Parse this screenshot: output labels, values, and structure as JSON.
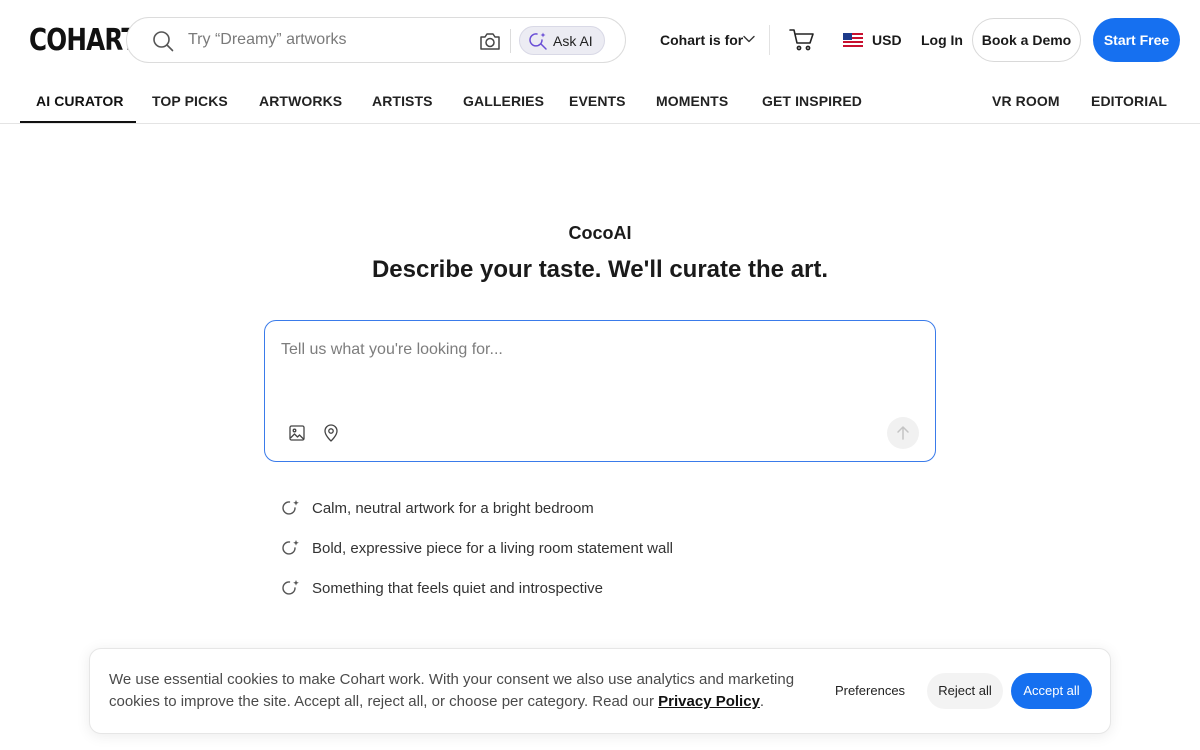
{
  "header": {
    "logo": "COHART",
    "search": {
      "placeholder": "Try “Dreamy” artworks",
      "ask_ai_label": "Ask AI"
    },
    "audience_menu_label": "Cohart is for",
    "currency": "USD",
    "login_label": "Log In",
    "demo_label": "Book a Demo",
    "start_label": "Start Free",
    "icons": {
      "search": "search-icon",
      "camera": "camera-icon",
      "ask_ai": "sparkle-search-icon",
      "cart": "cart-icon",
      "flag": "us-flag-icon",
      "chevron": "chevron-down-icon"
    }
  },
  "nav": {
    "items": [
      {
        "label": "AI CURATOR",
        "active": true
      },
      {
        "label": "TOP PICKS"
      },
      {
        "label": "ARTWORKS"
      },
      {
        "label": "ARTISTS"
      },
      {
        "label": "GALLERIES"
      },
      {
        "label": "EVENTS"
      },
      {
        "label": "MOMENTS"
      },
      {
        "label": "GET INSPIRED"
      },
      {
        "label": "VR ROOM"
      },
      {
        "label": "EDITORIAL"
      }
    ]
  },
  "main": {
    "brand": "CocoAI",
    "headline": "Describe your taste. We'll curate the art.",
    "prompt_placeholder": "Tell us what you're looking for...",
    "suggestions": [
      "Calm, neutral artwork for a bright bedroom",
      "Bold, expressive piece for a living room statement wall",
      "Something that feels quiet and introspective"
    ]
  },
  "cookie": {
    "text_before": "We use essential cookies to make Cohart work. With your consent we also use analytics and marketing cookies to improve the site. Accept all, reject all, or choose per category. Read our ",
    "link": "Privacy Policy",
    "text_after": ".",
    "preferences_label": "Preferences",
    "reject_label": "Reject all",
    "accept_label": "Accept all"
  },
  "colors": {
    "accent": "#1670f0",
    "focus_border": "#3a7bea"
  }
}
